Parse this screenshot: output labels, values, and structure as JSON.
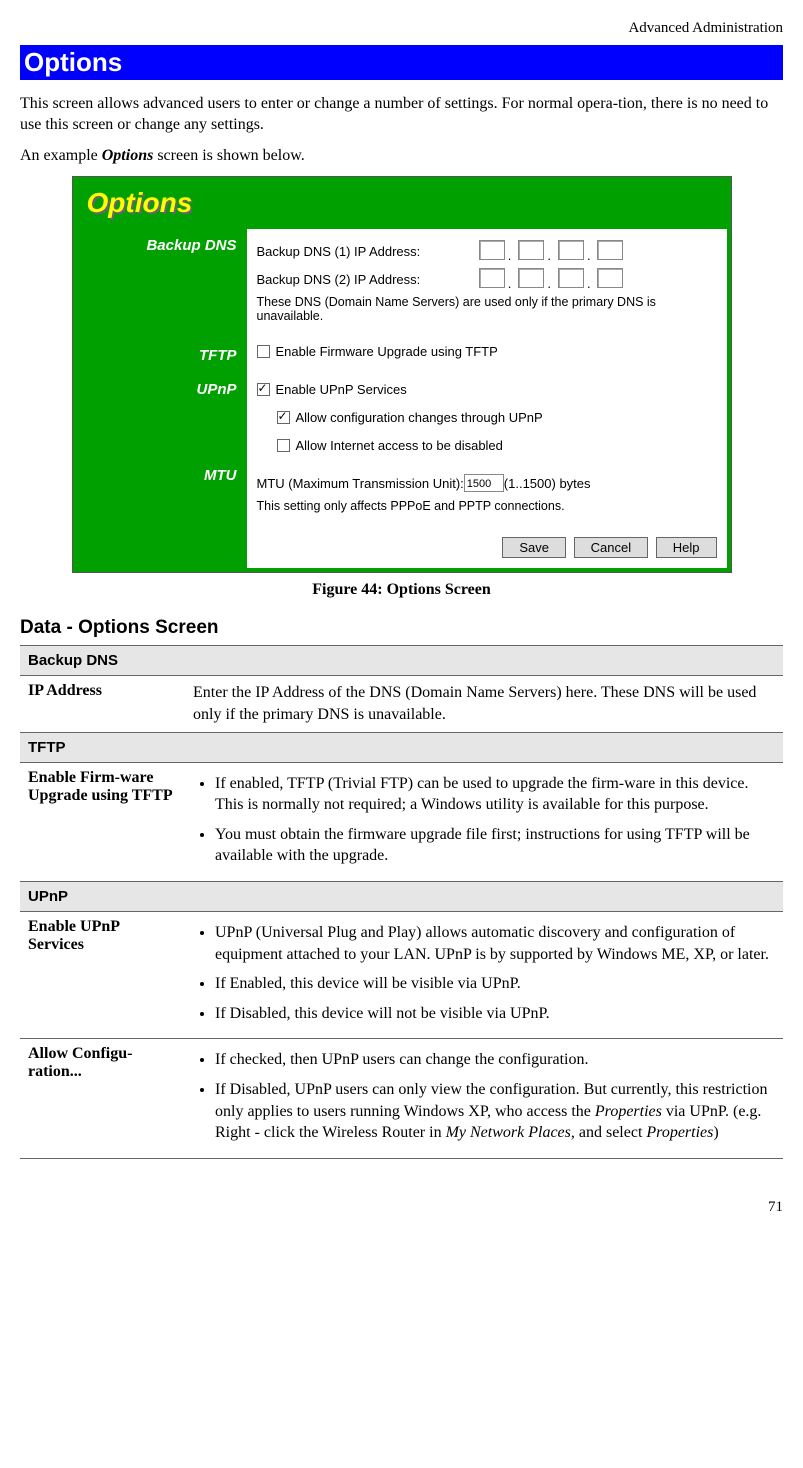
{
  "header_right": "Advanced Administration",
  "banner": "Options",
  "intro_p1": "This screen allows advanced users to enter or change a number of settings. For normal opera-tion, there is no need to use this screen or change any settings.",
  "intro_p2_a": "An example ",
  "intro_p2_b": "Options",
  "intro_p2_c": " screen is shown below.",
  "screenshot": {
    "title": "Options",
    "sidebar": {
      "backup_dns": "Backup DNS",
      "tftp": "TFTP",
      "upnp": "UPnP",
      "mtu": "MTU"
    },
    "dns1_label": "Backup DNS (1) IP Address:",
    "dns2_label": "Backup DNS (2) IP Address:",
    "dns_note": "These DNS (Domain Name Servers) are used only if the primary DNS is unavailable.",
    "tftp_cb": "Enable Firmware Upgrade using TFTP",
    "upnp_cb1": "Enable UPnP Services",
    "upnp_cb2": "Allow configuration changes through UPnP",
    "upnp_cb3": "Allow Internet access to be disabled",
    "mtu_label_a": "MTU (Maximum Transmission Unit): ",
    "mtu_value": "1500",
    "mtu_label_b": " (1..1500) bytes",
    "mtu_note": "This setting only affects PPPoE and PPTP connections.",
    "btn_save": "Save",
    "btn_cancel": "Cancel",
    "btn_help": "Help"
  },
  "figure_caption": "Figure 44: Options Screen",
  "section_title": "Data - Options Screen",
  "table": {
    "g1": "Backup DNS",
    "r1_key": "IP Address",
    "r1_val": "Enter the IP Address of the DNS (Domain Name Servers) here. These DNS will be used only if the primary DNS is unavailable.",
    "g2": "TFTP",
    "r2_key": "Enable Firm-ware Upgrade using TFTP",
    "r2_b1": "If enabled, TFTP (Trivial FTP) can be used to upgrade the firm-ware in this device. This is normally not required; a Windows utility is available for this purpose.",
    "r2_b2": "You must obtain the firmware upgrade file first; instructions for using TFTP will be available with the upgrade.",
    "g3": "UPnP",
    "r3_key": "Enable UPnP Services",
    "r3_b1": "UPnP (Universal Plug and Play) allows automatic discovery and configuration of equipment attached to your LAN. UPnP is by supported by Windows ME, XP, or later.",
    "r3_b2": "If Enabled, this device will be visible via UPnP.",
    "r3_b3": "If Disabled, this device will not be visible via UPnP.",
    "r4_key": "Allow Configu-ration...",
    "r4_b1": "If checked, then UPnP users can change the configuration.",
    "r4_b2_a": "If Disabled, UPnP users can only view the configuration. But currently, this restriction only applies to users running Windows XP, who access the ",
    "r4_b2_b": "Properties",
    "r4_b2_c": " via UPnP. (e.g. Right - click the Wireless Router in ",
    "r4_b2_d": "My Network Places",
    "r4_b2_e": ", and select ",
    "r4_b2_f": "Properties",
    "r4_b2_g": ")"
  },
  "page_number": "71"
}
